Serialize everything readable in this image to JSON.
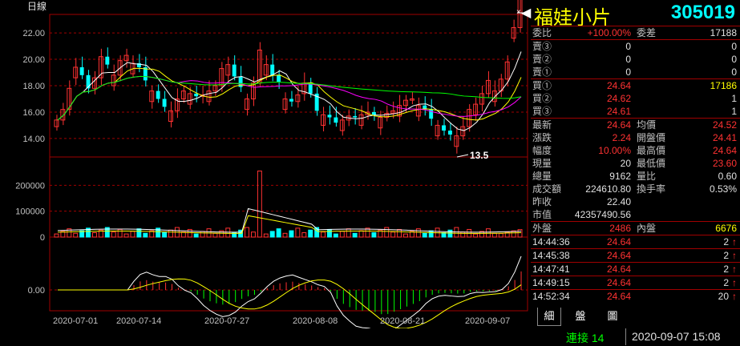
{
  "chart_label": "日線",
  "price_axis": [
    "22.00",
    "20.00",
    "18.00",
    "16.00",
    "14.00"
  ],
  "volume_axis": [
    "200000",
    "100000",
    "0"
  ],
  "indicator_axis": [
    "0.00"
  ],
  "low_marker": "13.5",
  "high_marker": "24.64",
  "dates": [
    "2020-07-01",
    "2020-07-14",
    "2020-07-27",
    "2020-08-08",
    "2020-08-21",
    "2020-09-07"
  ],
  "stock": {
    "name": "福娃小片",
    "code": "305019"
  },
  "order_book": {
    "ratio_label": "委比",
    "ratio_value": "+100.00%",
    "diff_label": "委差",
    "diff_value": "17188",
    "sells": [
      {
        "label": "賣③",
        "price": "0",
        "vol": "0"
      },
      {
        "label": "賣②",
        "price": "0",
        "vol": "0"
      },
      {
        "label": "賣①",
        "price": "0",
        "vol": "0"
      }
    ],
    "buys": [
      {
        "label": "買①",
        "price": "24.64",
        "vol": "17186"
      },
      {
        "label": "買②",
        "price": "24.62",
        "vol": "1"
      },
      {
        "label": "買③",
        "price": "24.61",
        "vol": "1"
      }
    ]
  },
  "quote": [
    {
      "l1": "最新",
      "v1": "24.64",
      "l2": "均價",
      "v2": "24.52"
    },
    {
      "l1": "漲跌",
      "v1": "2.24",
      "l2": "開盤價",
      "v2": "24.41"
    },
    {
      "l1": "幅度",
      "v1": "10.00%",
      "l2": "最高價",
      "v2": "24.64"
    },
    {
      "l1": "現量",
      "v1": "20",
      "l2": "最低價",
      "v2": "23.60"
    },
    {
      "l1": "總量",
      "v1": "9162",
      "l2": "量比",
      "v2": "0.60"
    },
    {
      "l1": "成交額",
      "v1": "224610.80",
      "l2": "換手率",
      "v2": "0.53%"
    },
    {
      "l1": "昨收",
      "v1": "22.40",
      "l2": "",
      "v2": ""
    },
    {
      "l1": "市值",
      "v1": "42357490.56",
      "l2": "",
      "v2": ""
    }
  ],
  "outer_inner": {
    "outer_label": "外盤",
    "outer_value": "2486",
    "inner_label": "內盤",
    "inner_value": "6676"
  },
  "ticks": [
    {
      "time": "14:44:36",
      "price": "24.64",
      "vol": "2",
      "dir": "↑"
    },
    {
      "time": "14:45:38",
      "price": "24.64",
      "vol": "2",
      "dir": "↑"
    },
    {
      "time": "14:47:41",
      "price": "24.64",
      "vol": "2",
      "dir": "↑"
    },
    {
      "time": "14:49:15",
      "price": "24.64",
      "vol": "2",
      "dir": "↑"
    },
    {
      "time": "14:52:34",
      "price": "24.64",
      "vol": "20",
      "dir": "↑"
    }
  ],
  "tabs": [
    "細",
    "盤",
    "圖"
  ],
  "status": {
    "connection": "連接 14",
    "datetime": "2020-09-07 15:08"
  },
  "colors": {
    "up": "#ff3232",
    "down": "#00ffff",
    "grid": "#a00000",
    "ma5": "#ffffff",
    "ma10": "#ffff00",
    "ma20": "#ff00ff",
    "ma60": "#00ff00"
  }
}
